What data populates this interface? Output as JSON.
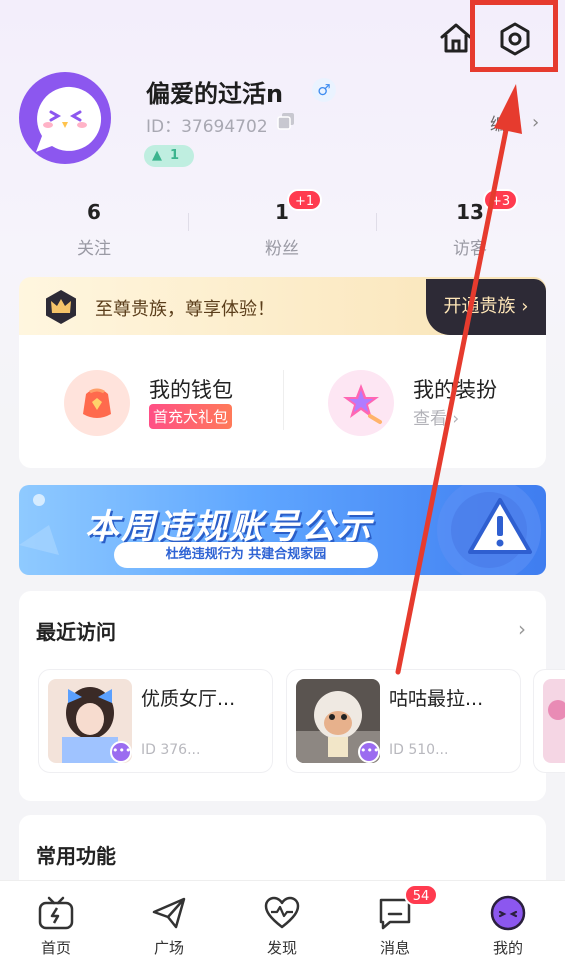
{
  "profile": {
    "username": "偏爱的过活n",
    "gender_symbol": "♂",
    "id_text": "ID：37694702",
    "level": "1",
    "profile_link": "编",
    "profile_chevron": "›"
  },
  "stats": [
    {
      "value": "6",
      "label": "关注"
    },
    {
      "value": "1",
      "label": "粉丝",
      "badge": "+1"
    },
    {
      "value": "13",
      "label": "访客",
      "badge": "+3"
    }
  ],
  "vip": {
    "text": "至尊贵族，尊享体验！",
    "button": "开通贵族 ›"
  },
  "wallet": {
    "title": "我的钱包",
    "tag": "首充大礼包"
  },
  "dressup": {
    "title": "我的装扮",
    "subtitle": "查看 ›"
  },
  "banner": {
    "title": "本周违规账号公示",
    "subtitle": "杜绝违规行为  共建合规家园"
  },
  "recent": {
    "title": "最近访问",
    "chevron": "›",
    "rooms": [
      {
        "name": "优质女厅...",
        "id": "ID 376..."
      },
      {
        "name": "咕咕最拉...",
        "id": "ID 510..."
      }
    ]
  },
  "common": {
    "title": "常用功能"
  },
  "nav": {
    "items": [
      "首页",
      "广场",
      "发现",
      "消息",
      "我的"
    ],
    "message_badge": "54"
  },
  "icons": {
    "home": "home-icon",
    "settings": "settings-icon",
    "copy": "copy-icon",
    "crown": "crown-icon",
    "wallet": "wallet-icon",
    "dressup": "dressup-icon",
    "warning": "warning-icon"
  },
  "colors": {
    "highlight": "#e63b2e",
    "accent_purple": "#8c57ef",
    "badge_red": "#ff3b4f",
    "vip_dark": "#2d2a36"
  }
}
